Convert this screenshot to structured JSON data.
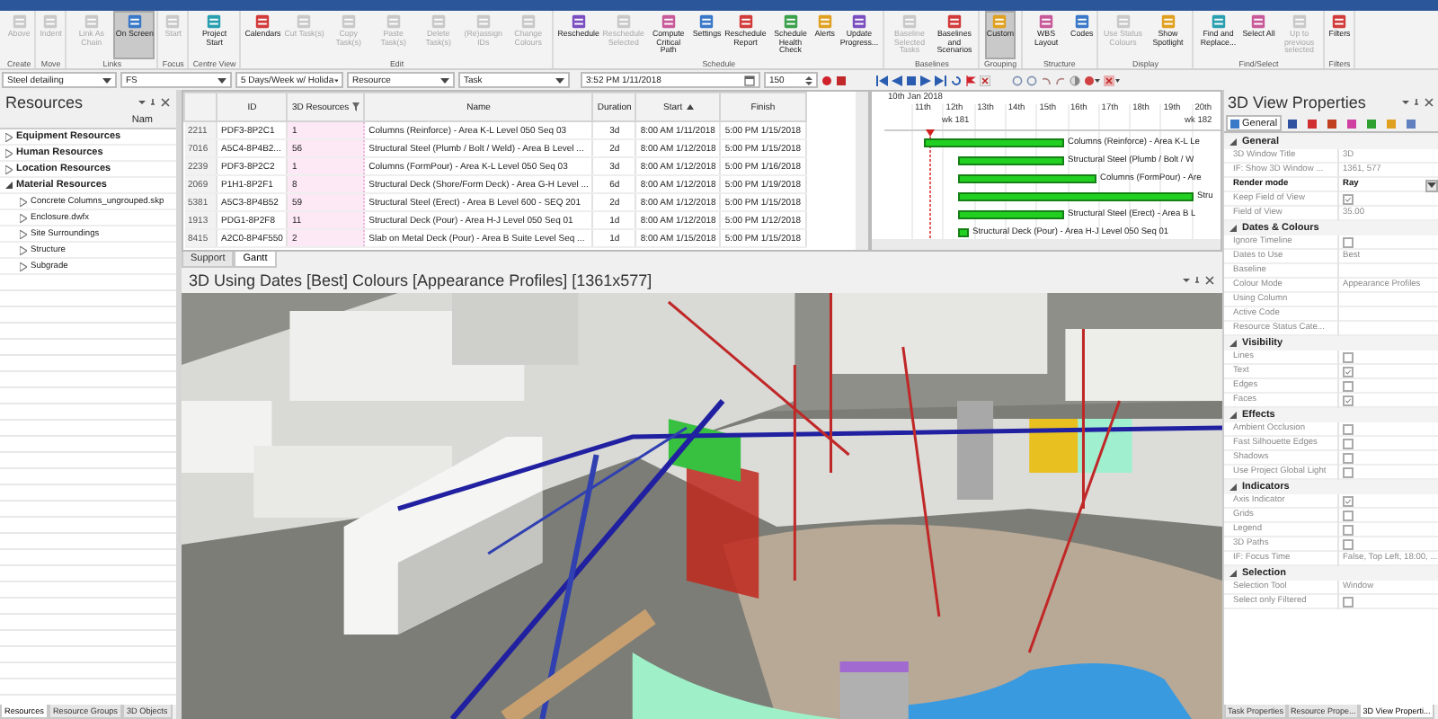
{
  "ribbon": {
    "groups": [
      {
        "label": "Create",
        "items": [
          {
            "label": "Above",
            "disabled": true,
            "pressed": false
          }
        ]
      },
      {
        "label": "Move",
        "items": [
          {
            "label": "Indent",
            "disabled": true,
            "pressed": false
          }
        ]
      },
      {
        "label": "Links",
        "items": [
          {
            "label": "Link As Chain",
            "disabled": true,
            "pressed": false
          },
          {
            "label": "On Screen",
            "disabled": false,
            "pressed": true
          }
        ]
      },
      {
        "label": "Focus",
        "items": [
          {
            "label": "Start",
            "disabled": true,
            "pressed": false
          }
        ]
      },
      {
        "label": "Centre View",
        "items": [
          {
            "label": "Project Start",
            "disabled": false,
            "pressed": false
          }
        ]
      },
      {
        "label": "Edit",
        "items": [
          {
            "label": "Calendars",
            "disabled": false,
            "pressed": false
          },
          {
            "label": "Cut Task(s)",
            "disabled": true,
            "pressed": false
          },
          {
            "label": "Copy Task(s)",
            "disabled": true,
            "pressed": false
          },
          {
            "label": "Paste Task(s)",
            "disabled": true,
            "pressed": false
          },
          {
            "label": "Delete Task(s)",
            "disabled": true,
            "pressed": false
          },
          {
            "label": "(Re)assign IDs",
            "disabled": true,
            "pressed": false
          },
          {
            "label": "Change Colours",
            "disabled": true,
            "pressed": false
          }
        ]
      },
      {
        "label": "Schedule",
        "items": [
          {
            "label": "Reschedule",
            "disabled": false,
            "pressed": false
          },
          {
            "label": "Reschedule Selected",
            "disabled": true,
            "pressed": false
          },
          {
            "label": "Compute Critical Path",
            "disabled": false,
            "pressed": false
          },
          {
            "label": "Settings",
            "disabled": false,
            "pressed": false
          },
          {
            "label": "Reschedule Report",
            "disabled": false,
            "pressed": false
          },
          {
            "label": "Schedule Health Check",
            "disabled": false,
            "pressed": false
          },
          {
            "label": "Alerts",
            "disabled": false,
            "pressed": false
          },
          {
            "label": "Update Progress...",
            "disabled": false,
            "pressed": false
          }
        ]
      },
      {
        "label": "Baselines",
        "items": [
          {
            "label": "Baseline Selected Tasks",
            "disabled": true,
            "pressed": false
          },
          {
            "label": "Baselines and Scenarios",
            "disabled": false,
            "pressed": false
          }
        ]
      },
      {
        "label": "Grouping",
        "items": [
          {
            "label": "Custom",
            "disabled": false,
            "pressed": true
          }
        ]
      },
      {
        "label": "Structure",
        "items": [
          {
            "label": "WBS Layout",
            "disabled": false,
            "pressed": false
          },
          {
            "label": "Codes",
            "disabled": false,
            "pressed": false
          }
        ]
      },
      {
        "label": "Display",
        "items": [
          {
            "label": "Use Status Colours",
            "disabled": true,
            "pressed": false
          },
          {
            "label": "Show Spotlight",
            "disabled": false,
            "pressed": false
          }
        ]
      },
      {
        "label": "Find/Select",
        "items": [
          {
            "label": "Find and Replace...",
            "disabled": false,
            "pressed": false
          },
          {
            "label": "Select All",
            "disabled": false,
            "pressed": false
          },
          {
            "label": "Up to previous selected",
            "disabled": true,
            "pressed": false
          }
        ]
      },
      {
        "label": "Filters",
        "items": [
          {
            "label": "Filters",
            "disabled": false,
            "pressed": false
          }
        ]
      }
    ]
  },
  "toolbar": {
    "fields": [
      {
        "value": "Steel detailing"
      },
      {
        "value": "FS"
      },
      {
        "value": "5 Days/Week w/ Holida"
      },
      {
        "value": "Resource"
      },
      {
        "value": "Task"
      }
    ],
    "date_time": "3:52 PM  1/11/2018",
    "zoom": "150"
  },
  "resources": {
    "title": "Resources",
    "column": "Nam",
    "tree": [
      {
        "label": "Equipment Resources",
        "expanded": false
      },
      {
        "label": "Human Resources",
        "expanded": false
      },
      {
        "label": "Location Resources",
        "expanded": false
      },
      {
        "label": "Material Resources",
        "expanded": true,
        "children": [
          {
            "label": "Concrete Columns_ungrouped.skp",
            "expanded": false
          },
          {
            "label": "Enclosure.dwfx",
            "expanded": false
          },
          {
            "label": "Site Surroundings",
            "expanded": false
          },
          {
            "label": "Structure",
            "expanded": false
          },
          {
            "label": "Subgrade",
            "expanded": false
          }
        ]
      }
    ],
    "tabs": [
      {
        "label": "Resources",
        "selected": true
      },
      {
        "label": "Resource Groups",
        "selected": false
      },
      {
        "label": "3D Objects",
        "selected": false
      }
    ]
  },
  "table": {
    "columns": [
      "ID",
      "3D Resources",
      "Name",
      "Duration",
      "Start",
      "Finish"
    ],
    "rows": [
      {
        "row_number": "2211",
        "cells": [
          "PDF3-8P2C1",
          "1",
          "Columns (Reinforce) - Area K-L Level 050 Seq 03",
          "3d",
          "8:00 AM 1/11/2018",
          "5:00 PM 1/15/2018"
        ]
      },
      {
        "row_number": "7016",
        "cells": [
          "A5C4-8P4B2...",
          "56",
          "Structural Steel (Plumb / Bolt / Weld) - Area B Level ...",
          "2d",
          "8:00 AM 1/12/2018",
          "5:00 PM 1/15/2018"
        ]
      },
      {
        "row_number": "2239",
        "cells": [
          "PDF3-8P2C2",
          "1",
          "Columns (FormPour) - Area K-L Level 050 Seq 03",
          "3d",
          "8:00 AM 1/12/2018",
          "5:00 PM 1/16/2018"
        ]
      },
      {
        "row_number": "2069",
        "cells": [
          "P1H1-8P2F1",
          "8",
          "Structural Deck (Shore/Form Deck) - Area G-H Level ...",
          "6d",
          "8:00 AM 1/12/2018",
          "5:00 PM 1/19/2018"
        ]
      },
      {
        "row_number": "5381",
        "cells": [
          "A5C3-8P4B52",
          "59",
          "Structural Steel (Erect) - Area B Level 600 - SEQ 201",
          "2d",
          "8:00 AM 1/12/2018",
          "5:00 PM 1/15/2018"
        ]
      },
      {
        "row_number": "1913",
        "cells": [
          "PDG1-8P2F8",
          "11",
          "Structural Deck (Pour) - Area H-J Level 050 Seq 01",
          "1d",
          "8:00 AM 1/12/2018",
          "5:00 PM 1/12/2018"
        ]
      },
      {
        "row_number": "8415",
        "cells": [
          "A2C0-8P4F550",
          "2",
          "Slab on Metal Deck (Pour) - Area B Suite Level Seq ...",
          "1d",
          "8:00 AM 1/15/2018",
          "5:00 PM 1/15/2018"
        ]
      }
    ],
    "tabs": [
      {
        "label": "Support",
        "selected": false
      },
      {
        "label": "Gantt",
        "selected": true
      }
    ]
  },
  "gantt": {
    "date_label": "10th Jan 2018",
    "days": [
      "11th",
      "12th",
      "13th",
      "14th",
      "15th",
      "16th",
      "17th",
      "18th",
      "19th",
      "20th"
    ],
    "weeks": [
      "wk 181",
      "wk 182"
    ],
    "bars": [
      {
        "label": "Columns (Reinforce) - Area K-L Le"
      },
      {
        "label": "Structural Steel (Plumb / Bolt / W"
      },
      {
        "label": "Columns (FormPour) - Are"
      },
      {
        "label": "Stru"
      },
      {
        "label": "Structural Steel (Erect) - Area B L"
      },
      {
        "label": "Structural Deck (Pour) - Area H-J Level 050 Seq 01"
      }
    ]
  },
  "view_3d": {
    "title": "3D Using Dates [Best] Colours [Appearance Profiles]  [1361x577]"
  },
  "properties": {
    "title": "3D View Properties",
    "tabs": [
      {
        "label": "General",
        "selected": true
      },
      {
        "selected": false
      },
      {
        "selected": false
      },
      {
        "selected": false
      },
      {
        "selected": false
      },
      {
        "selected": false
      },
      {
        "selected": false
      },
      {
        "selected": false
      }
    ],
    "categories": [
      {
        "label": "General",
        "expanded": true,
        "rows": [
          {
            "label": "3D Window Title",
            "kind": "text",
            "value": "3D"
          },
          {
            "label": "IF: Show 3D Window ...",
            "kind": "text",
            "value": "1361, 577"
          },
          {
            "label": "Render mode",
            "kind": "dropdown",
            "value": "Ray"
          },
          {
            "label": "Keep Field of View",
            "kind": "check",
            "checked": true
          },
          {
            "label": "Field of View",
            "kind": "text",
            "value": "35.00"
          }
        ]
      },
      {
        "label": "Dates & Colours",
        "expanded": true,
        "rows": [
          {
            "label": "Ignore Timeline",
            "kind": "check",
            "checked": false
          },
          {
            "label": "Dates to Use",
            "kind": "text",
            "value": "Best"
          },
          {
            "label": "Baseline",
            "kind": "text"
          },
          {
            "label": "Colour Mode",
            "kind": "text",
            "value": "Appearance Profiles"
          },
          {
            "label": "Using Column",
            "kind": "text"
          },
          {
            "label": "Active Code",
            "kind": "text"
          },
          {
            "label": "Resource Status Cate...",
            "kind": "text"
          }
        ]
      },
      {
        "label": "Visibility",
        "expanded": true,
        "rows": [
          {
            "label": "Lines",
            "kind": "check",
            "checked": false
          },
          {
            "label": "Text",
            "kind": "check",
            "checked": true
          },
          {
            "label": "Edges",
            "kind": "check",
            "checked": false
          },
          {
            "label": "Faces",
            "kind": "check",
            "checked": true
          }
        ]
      },
      {
        "label": "Effects",
        "expanded": true,
        "rows": [
          {
            "label": "Ambient Occlusion",
            "kind": "check",
            "checked": false
          },
          {
            "label": "Fast Silhouette Edges",
            "kind": "check",
            "checked": false
          },
          {
            "label": "Shadows",
            "kind": "check",
            "checked": false
          },
          {
            "label": "Use Project Global Light",
            "kind": "check",
            "checked": false
          }
        ]
      },
      {
        "label": "Indicators",
        "expanded": true,
        "rows": [
          {
            "label": "Axis Indicator",
            "kind": "check",
            "checked": true
          },
          {
            "label": "Grids",
            "kind": "check",
            "checked": false
          },
          {
            "label": "Legend",
            "kind": "check",
            "checked": false
          },
          {
            "label": "3D Paths",
            "kind": "check",
            "checked": false
          },
          {
            "label": "IF: Focus Time",
            "kind": "text",
            "value": "False, Top Left, 18:00, ..."
          }
        ]
      },
      {
        "label": "Selection",
        "expanded": true,
        "rows": [
          {
            "label": "Selection Tool",
            "kind": "text",
            "value": "Window"
          },
          {
            "label": "Select only Filtered",
            "kind": "check",
            "checked": false
          }
        ]
      }
    ],
    "bottom_tabs": [
      {
        "label": "Task Properties",
        "selected": false
      },
      {
        "label": "Resource Prope...",
        "selected": false
      },
      {
        "label": "3D View Properti...",
        "selected": true
      }
    ]
  }
}
